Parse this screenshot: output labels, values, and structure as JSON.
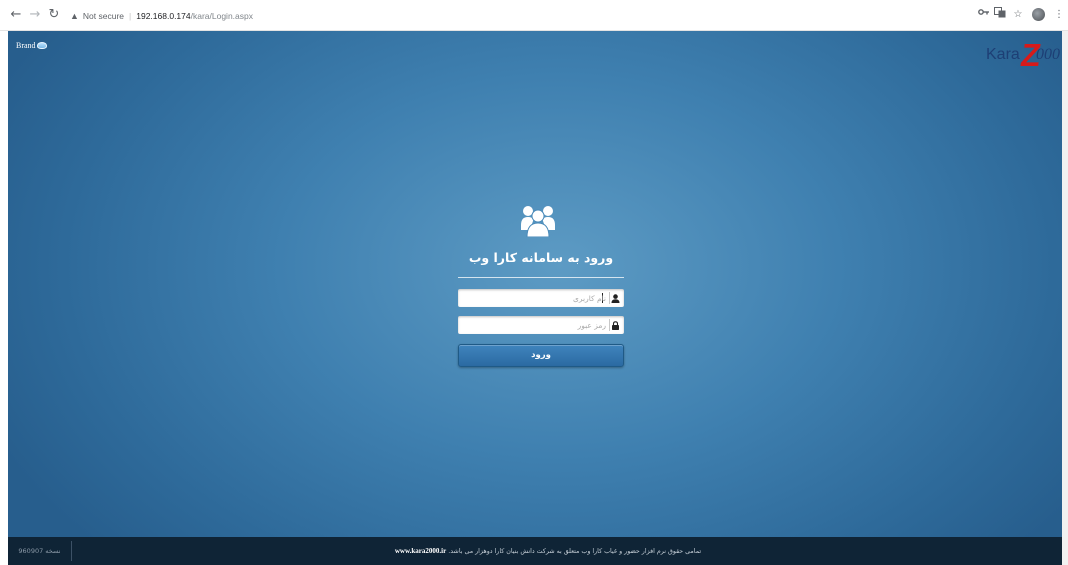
{
  "browser": {
    "security_label": "Not secure",
    "url_host": "192.168.0.174",
    "url_path": "/kara/Login.aspx"
  },
  "page": {
    "brand_text": "Brand",
    "logo": {
      "part1": "Kara",
      "part2": "Z",
      "part3": "000"
    },
    "colors": {
      "background": "#3f80b0",
      "footer": "#0f2436",
      "logo_red": "#d71a1a",
      "logo_blue": "#1d3f75"
    },
    "icons": {
      "header": "users-icon",
      "username": "user-icon",
      "password": "lock-icon"
    }
  },
  "login": {
    "title": "ورود به سامانه کارا وب",
    "username_placeholder": "نام کاربری",
    "username_value": "",
    "password_placeholder": "رمز عبور",
    "password_value": "",
    "submit_label": "ورود"
  },
  "footer": {
    "version": "نسخه 960907",
    "copyright_text": "تمامی حقوق نرم افزار حضور و غیاب کارا وب متعلق به شرکت دانش بنیان کارا دوهزار می باشد.",
    "website": "www.kara2000.ir"
  }
}
